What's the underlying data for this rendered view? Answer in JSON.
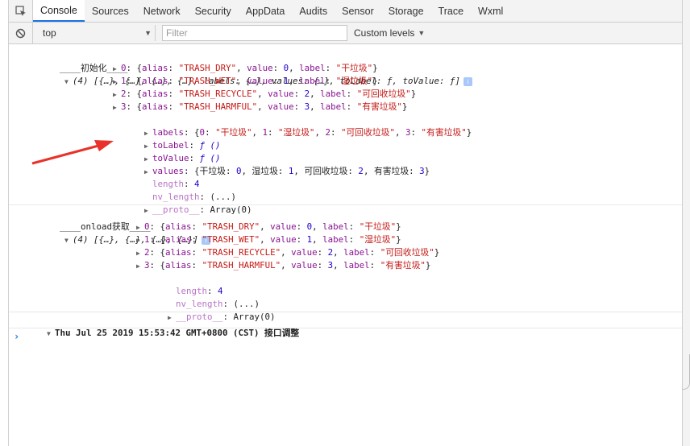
{
  "tabs": [
    {
      "label": "Console",
      "active": true
    },
    {
      "label": "Sources"
    },
    {
      "label": "Network"
    },
    {
      "label": "Security"
    },
    {
      "label": "AppData"
    },
    {
      "label": "Audits"
    },
    {
      "label": "Sensor"
    },
    {
      "label": "Storage"
    },
    {
      "label": "Trace"
    },
    {
      "label": "Wxml"
    }
  ],
  "filter": {
    "context": "top",
    "placeholder": "Filter",
    "levels": "Custom levels"
  },
  "log1": {
    "prefix": "____初始化____",
    "summary": "(4) [{…}, {…}, {…}, {…}, labels: {…}, values: {…}, toLabel: ƒ, toValue: ƒ]",
    "items": [
      {
        "key": "0",
        "alias": "\"TRASH_DRY\"",
        "value": "0",
        "label": "\"干垃圾\""
      },
      {
        "key": "1",
        "alias": "\"TRASH_WET\"",
        "value": "1",
        "label": "\"湿垃圾\""
      },
      {
        "key": "2",
        "alias": "\"TRASH_RECYCLE\"",
        "value": "2",
        "label": "\"可回收垃圾\""
      },
      {
        "key": "3",
        "alias": "\"TRASH_HARMFUL\"",
        "value": "3",
        "label": "\"有害垃圾\""
      }
    ],
    "labels_key": "labels",
    "labels_entries": [
      {
        "k": "0",
        "v": "\"干垃圾\""
      },
      {
        "k": "1",
        "v": "\"湿垃圾\""
      },
      {
        "k": "2",
        "v": "\"可回收垃圾\""
      },
      {
        "k": "3",
        "v": "\"有害垃圾\""
      }
    ],
    "toLabel_key": "toLabel",
    "toLabel_val": "ƒ ()",
    "toValue_key": "toValue",
    "toValue_val": "ƒ ()",
    "values_key": "values",
    "values_entries": [
      {
        "k": "干垃圾",
        "v": "0"
      },
      {
        "k": "湿垃圾",
        "v": "1"
      },
      {
        "k": "可回收垃圾",
        "v": "2"
      },
      {
        "k": "有害垃圾",
        "v": "3"
      }
    ],
    "length_key": "length",
    "length_val": "4",
    "nv_key": "nv_length",
    "nv_val": "(...)",
    "proto_key": "__proto__",
    "proto_val": "Array(0)"
  },
  "log2": {
    "prefix": "____onload获取____",
    "summary": "(4) [{…}, {…}, {…}, {…}]",
    "items": [
      {
        "key": "0",
        "alias": "\"TRASH_DRY\"",
        "value": "0",
        "label": "\"干垃圾\""
      },
      {
        "key": "1",
        "alias": "\"TRASH_WET\"",
        "value": "1",
        "label": "\"湿垃圾\""
      },
      {
        "key": "2",
        "alias": "\"TRASH_RECYCLE\"",
        "value": "2",
        "label": "\"可回收垃圾\""
      },
      {
        "key": "3",
        "alias": "\"TRASH_HARMFUL\"",
        "value": "3",
        "label": "\"有害垃圾\""
      }
    ],
    "length_key": "length",
    "length_val": "4",
    "nv_key": "nv_length",
    "nv_val": "(...)",
    "proto_key": "__proto__",
    "proto_val": "Array(0)"
  },
  "log3": {
    "text": "Thu Jul 25 2019 15:53:42 GMT+0800 (CST) 接口调整"
  },
  "prompt_glyph": "›",
  "info_badge": "i",
  "colors": {
    "annotation_arrow": "#e8322a",
    "active_tab_underline": "#1a73e8",
    "string": "#c41a16",
    "number": "#1c00cf",
    "property": "#881391"
  }
}
